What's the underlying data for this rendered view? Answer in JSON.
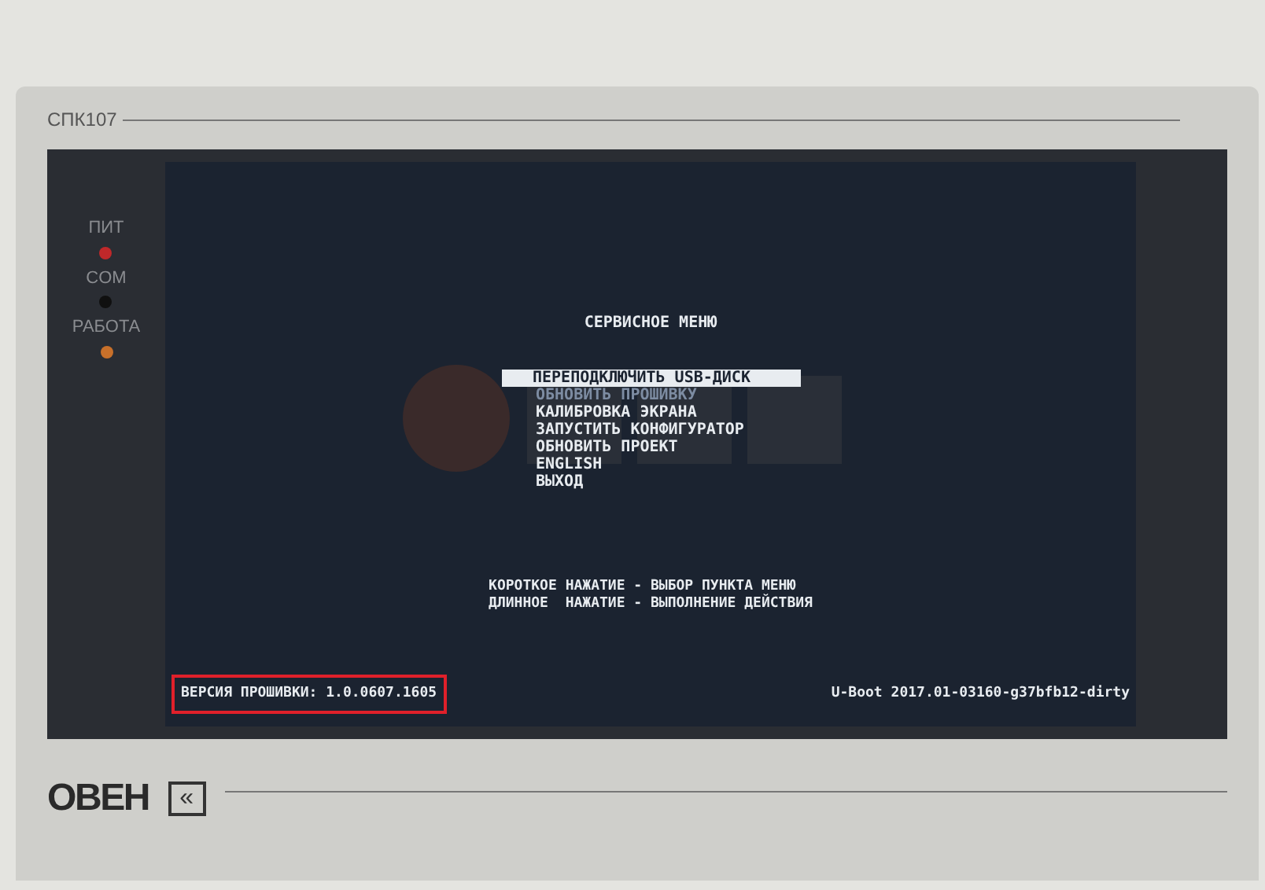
{
  "device": {
    "model": "СПК107",
    "brand": "ОВЕН",
    "back_key": "«"
  },
  "indicators": [
    {
      "label": "ПИТ",
      "color": "#c0282a"
    },
    {
      "label": "COM",
      "color": "#101010"
    },
    {
      "label": "РАБОТА",
      "color": "#c8702a"
    }
  ],
  "screen": {
    "title": "СЕРВИСНОЕ МЕНЮ",
    "menu": [
      {
        "label": "ПЕРЕПОДКЛЮЧИТЬ USB-ДИСК",
        "selected": true,
        "disabled": false
      },
      {
        "label": "ОБНОВИТЬ ПРОШИВКУ",
        "selected": false,
        "disabled": true
      },
      {
        "label": "КАЛИБРОВКА ЭКРАНА",
        "selected": false,
        "disabled": false
      },
      {
        "label": "ЗАПУСТИТЬ КОНФИГУРАТОР",
        "selected": false,
        "disabled": false
      },
      {
        "label": "ОБНОВИТЬ ПРОЕКТ",
        "selected": false,
        "disabled": false
      },
      {
        "label": "ENGLISH",
        "selected": false,
        "disabled": false
      },
      {
        "label": "ВЫХОД",
        "selected": false,
        "disabled": false
      }
    ],
    "hints": [
      "КОРОТКОЕ НАЖАТИЕ - ВЫБОР ПУНКТА МЕНЮ",
      "ДЛИННОЕ  НАЖАТИЕ - ВЫПОЛНЕНИЕ ДЕЙСТВИЯ"
    ],
    "firmware_version": {
      "text": "ВЕРСИЯ ПРОШИВКИ: 1.0.0607.1605",
      "highlighted": true
    },
    "bootloader": "U-Boot 2017.01-03160-g37bfb12-dirty"
  }
}
